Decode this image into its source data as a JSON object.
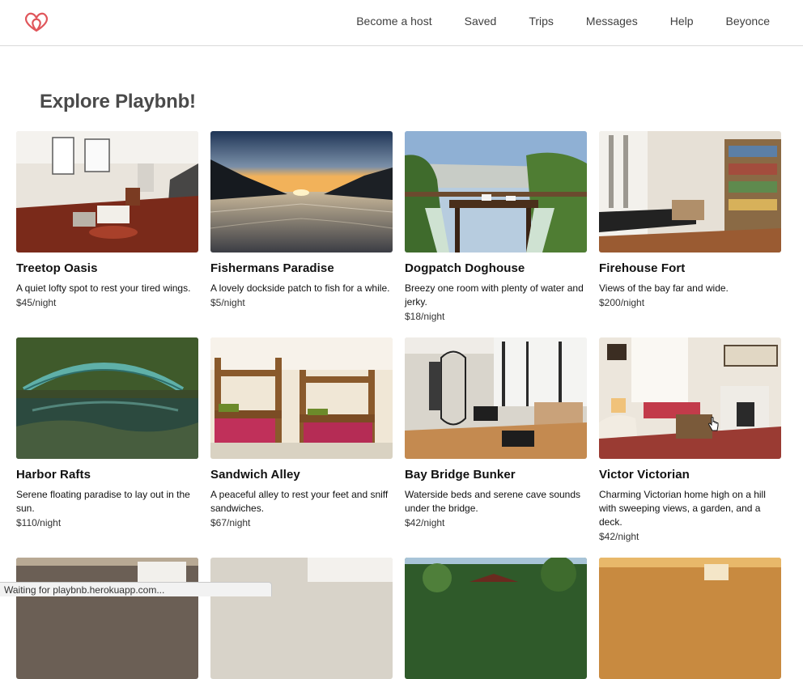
{
  "nav": {
    "logo_icon": "airbnb-belo-icon",
    "links": [
      "Become a host",
      "Saved",
      "Trips",
      "Messages",
      "Help",
      "Beyonce"
    ]
  },
  "page": {
    "title": "Explore Playbnb!"
  },
  "listings": [
    {
      "name": "Treetop Oasis",
      "description": "A quiet lofty spot to rest your tired wings.",
      "price": "$45/night"
    },
    {
      "name": "Fishermans Paradise",
      "description": "A lovely dockside patch to fish for a while.",
      "price": "$5/night"
    },
    {
      "name": "Dogpatch Doghouse",
      "description": "Breezy one room with plenty of water and jerky.",
      "price": "$18/night"
    },
    {
      "name": "Firehouse Fort",
      "description": "Views of the bay far and wide.",
      "price": "$200/night"
    },
    {
      "name": "Harbor Rafts",
      "description": "Serene floating paradise to lay out in the sun.",
      "price": "$110/night"
    },
    {
      "name": "Sandwich Alley",
      "description": "A peaceful alley to rest your feet and sniff sandwiches.",
      "price": "$67/night"
    },
    {
      "name": "Bay Bridge Bunker",
      "description": "Waterside beds and serene cave sounds under the bridge.",
      "price": "$42/night"
    },
    {
      "name": "Victor Victorian",
      "description": "Charming Victorian home high on a hill with sweeping views, a garden, and a deck.",
      "price": "$42/night"
    }
  ],
  "status": {
    "text": "Waiting for playbnb.herokuapp.com..."
  },
  "colors": {
    "brand": "#e0565b",
    "title": "#4a4a4a",
    "border": "#d9d9d9"
  }
}
